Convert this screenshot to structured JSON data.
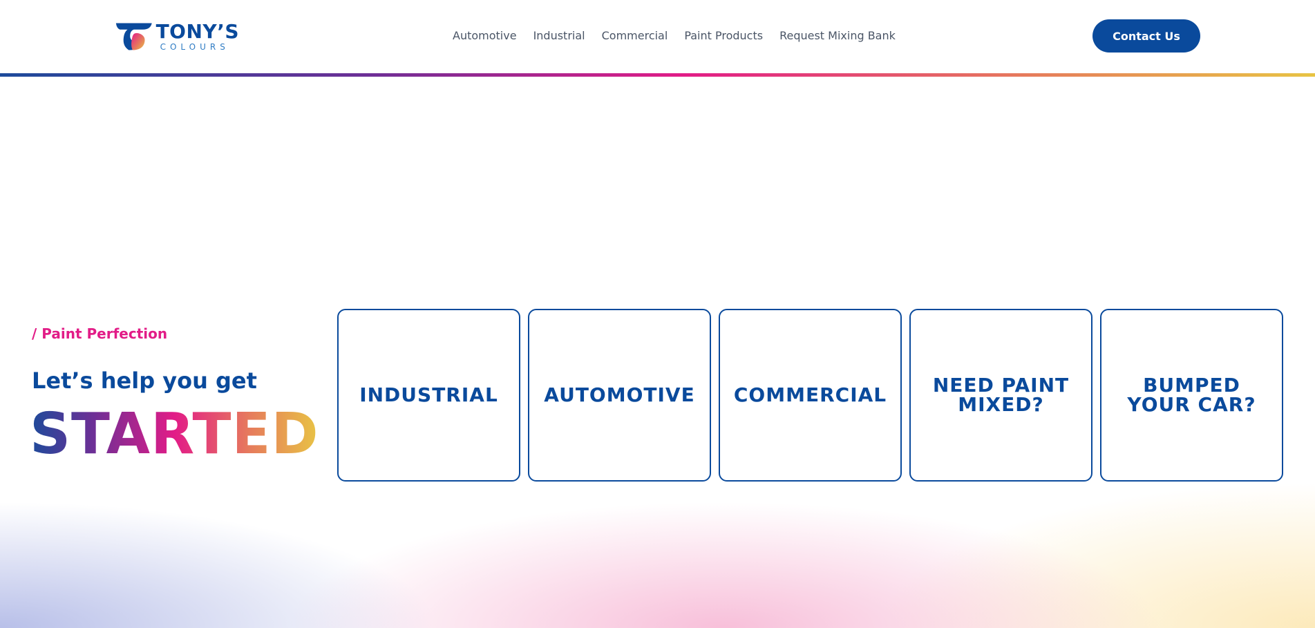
{
  "header": {
    "logo": {
      "main": "TONY’S",
      "sub": "COLOURS"
    },
    "nav": [
      {
        "label": "Automotive"
      },
      {
        "label": "Industrial"
      },
      {
        "label": "Commercial"
      },
      {
        "label": "Paint Products"
      },
      {
        "label": "Request Mixing Bank"
      }
    ],
    "contact_label": "Contact Us"
  },
  "hero": {
    "tagline": "/ Paint Perfection",
    "lead": "Let’s help you get",
    "headline": "STARTED"
  },
  "cards": [
    {
      "label": "INDUSTRIAL"
    },
    {
      "label": "AUTOMOTIVE"
    },
    {
      "label": "COMMERCIAL"
    },
    {
      "label": "NEED PAINT MIXED?"
    },
    {
      "label": "BUMPED YOUR CAR?"
    }
  ],
  "colors": {
    "brand_blue": "#0a4a9c",
    "accent_pink": "#e21c87",
    "gradient": [
      "#1d4b9b",
      "#6d2f96",
      "#e21c87",
      "#e67b5c",
      "#e8c444"
    ]
  }
}
